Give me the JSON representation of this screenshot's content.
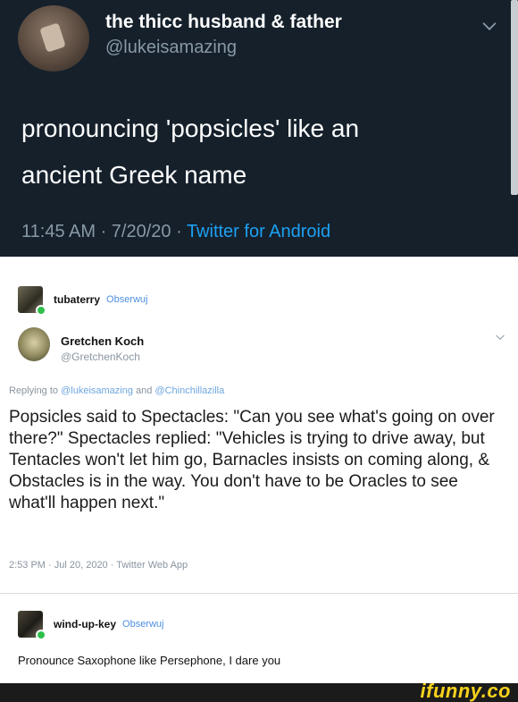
{
  "tweet": {
    "display_name": "the thicc husband & father",
    "handle": "@lukeisamazing",
    "text_line1": "pronouncing 'popsicles' like an",
    "text_line2": "ancient Greek name",
    "time_date": "11:45 AM · 7/20/20 · ",
    "source": "Twitter for Android",
    "theme_bg": "#15202b",
    "accent": "#1da1f2"
  },
  "post1": {
    "username": "tubaterry",
    "subtitle": "Obserwuj"
  },
  "reply": {
    "display_name": "Gretchen Koch",
    "handle": "@GretchenKoch",
    "replying_prefix": "Replying to ",
    "replying_user1": "@lukeisamazing",
    "replying_and": " and ",
    "replying_user2": "@Chinchillazilla",
    "text": "Popsicles said to Spectacles: \"Can you see what's going on over there?\" Spectacles replied: \"Vehicles is trying to drive away, but Tentacles won't let him go, Barnacles insists on coming along, & Obstacles is in the way. You don't have to be Oracles to see what'll happen next.\"",
    "meta": "2:53 PM · Jul 20, 2020 · Twitter Web App"
  },
  "post2": {
    "username": "wind-up-key",
    "subtitle": "Obserwuj",
    "comment": "Pronounce Saxophone like Persephone, I dare you"
  },
  "footer": {
    "watermark": "ifunny.co",
    "watermark_color": "#f7d21c"
  }
}
